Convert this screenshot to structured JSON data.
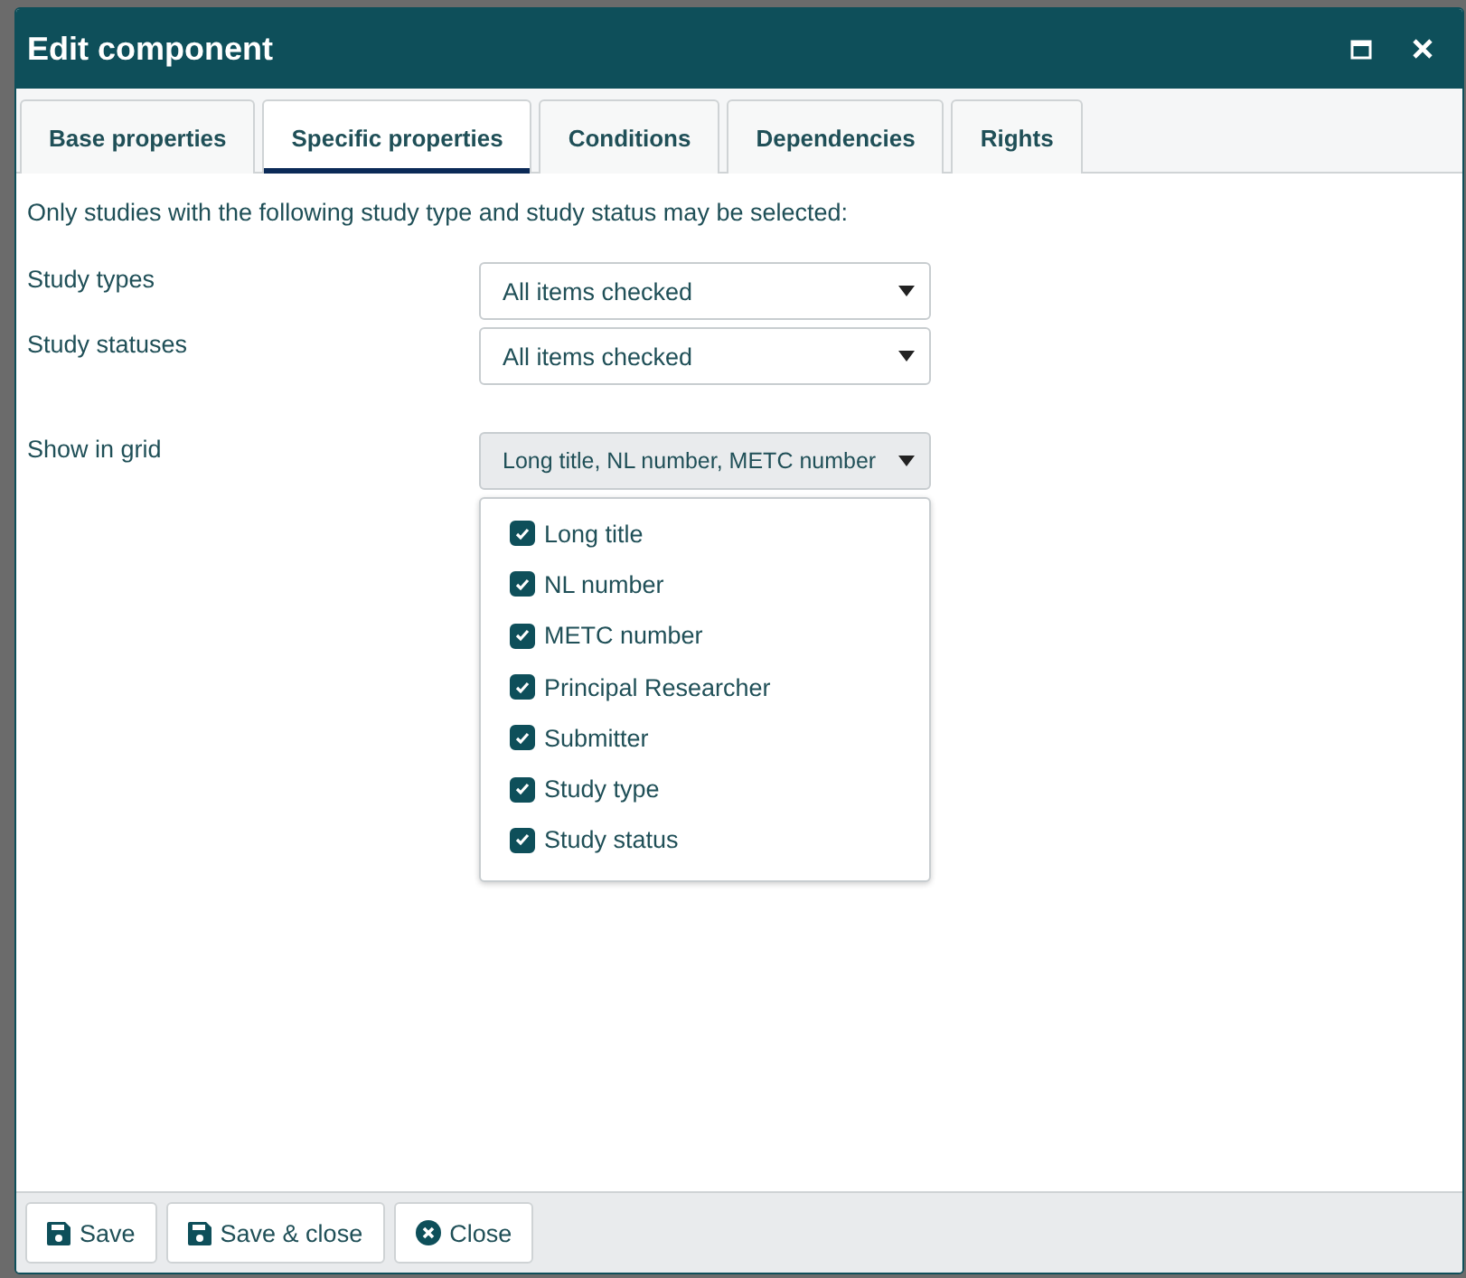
{
  "window": {
    "title": "Edit component"
  },
  "tabs": [
    {
      "label": "Base properties",
      "selected": false
    },
    {
      "label": "Specific properties",
      "selected": true
    },
    {
      "label": "Conditions",
      "selected": false
    },
    {
      "label": "Dependencies",
      "selected": false
    },
    {
      "label": "Rights",
      "selected": false
    }
  ],
  "intro": "Only studies with the following study type and study status may be selected:",
  "fields": [
    {
      "label": "Study types",
      "value": "All items checked",
      "open": false
    },
    {
      "label": "Study statuses",
      "value": "All items checked",
      "open": false
    },
    {
      "label": "Show in grid",
      "value": "Long title, NL number, METC number",
      "open": true,
      "options": [
        {
          "label": "Long title",
          "checked": true
        },
        {
          "label": "NL number",
          "checked": true
        },
        {
          "label": "METC number",
          "checked": true
        },
        {
          "label": "Principal Researcher",
          "checked": true
        },
        {
          "label": "Submitter",
          "checked": true
        },
        {
          "label": "Study type",
          "checked": true
        },
        {
          "label": "Study status",
          "checked": true
        }
      ]
    }
  ],
  "buttons": [
    {
      "label": "Save",
      "kind": "save"
    },
    {
      "label": "Save & close",
      "kind": "save"
    },
    {
      "label": "Close",
      "kind": "close"
    }
  ]
}
